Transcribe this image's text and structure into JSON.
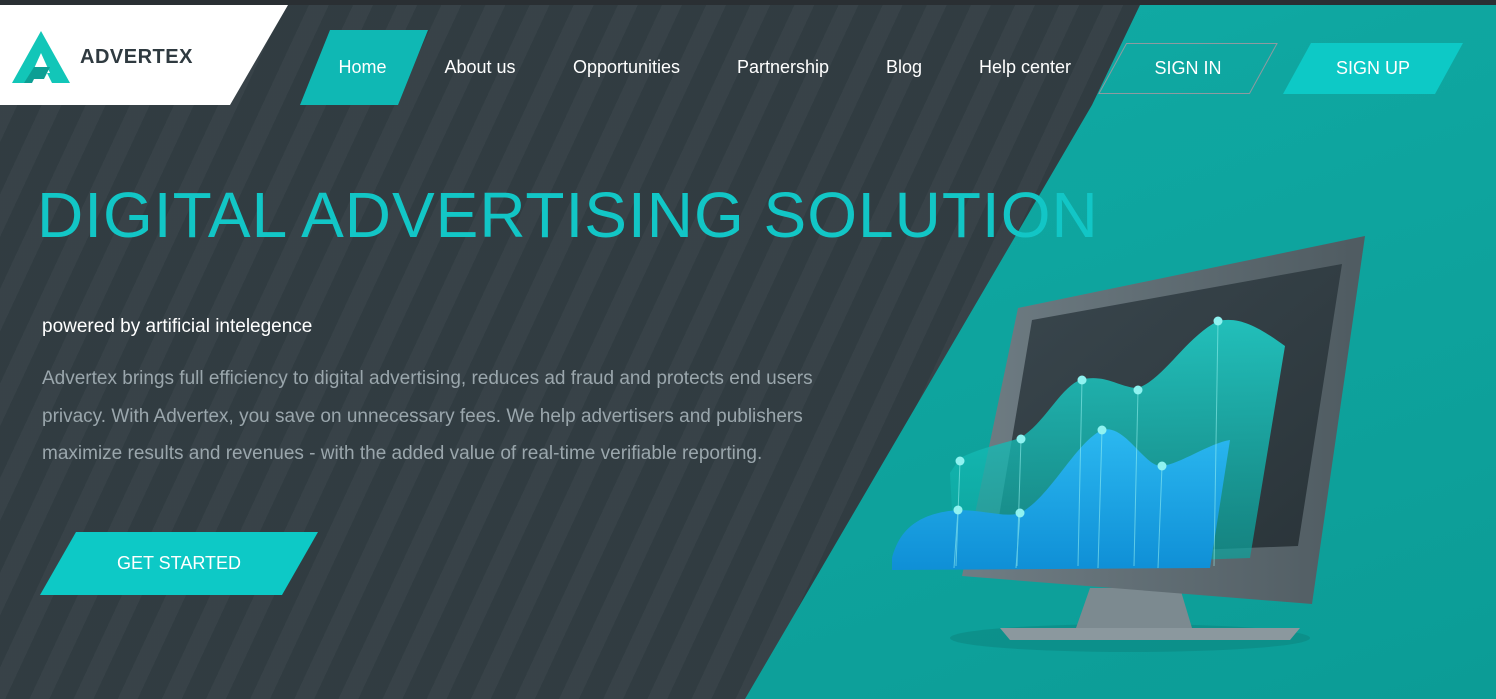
{
  "brand": {
    "name": "ADVERTEX",
    "accent_color": "#0dc9c6",
    "dark_color": "#2f3a40"
  },
  "nav": {
    "items": [
      {
        "label": "Home",
        "active": true
      },
      {
        "label": "About us"
      },
      {
        "label": "Opportunities"
      },
      {
        "label": "Partnership"
      },
      {
        "label": "Blog"
      },
      {
        "label": "Help center"
      }
    ],
    "sign_in": "SIGN IN",
    "sign_up": "SIGN UP"
  },
  "hero": {
    "title": "DIGITAL ADVERTISING SOLUTION",
    "subtitle": "powered by artificial intelegence",
    "description": "Advertex brings full efficiency to digital advertising, reduces ad fraud and protects end users privacy. With Advertex, you save on unnecessary fees. We help advertisers and publishers maximize results and revenues - with the added value of real-time verifiable reporting.",
    "cta": "GET STARTED"
  },
  "illustration": {
    "icon": "monitor-chart-icon"
  }
}
